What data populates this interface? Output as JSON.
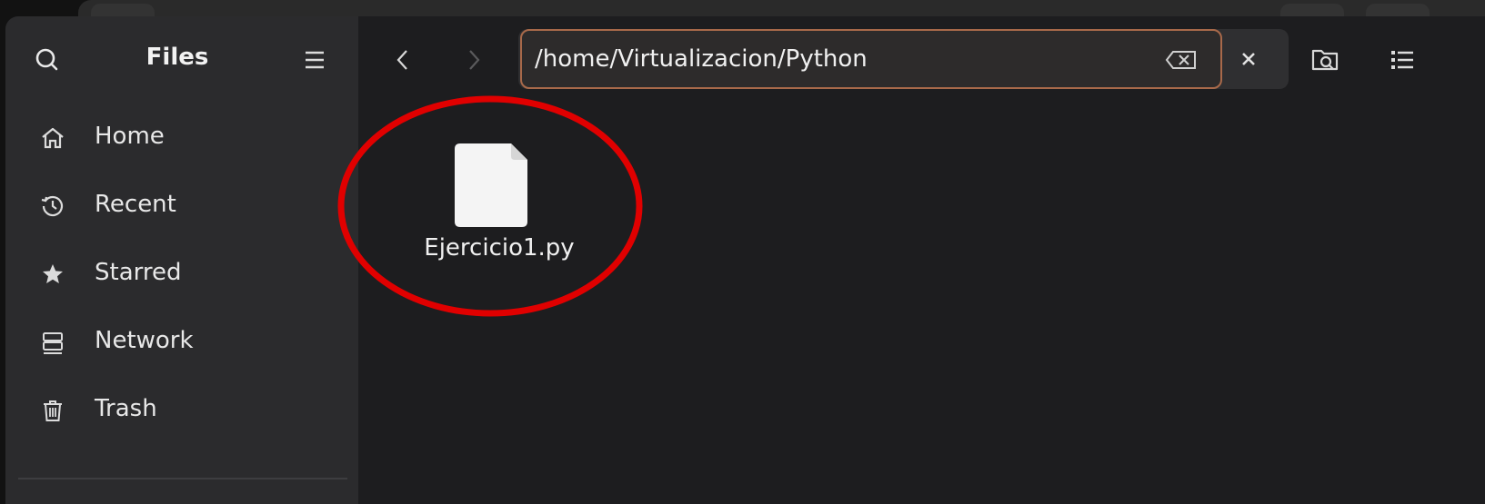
{
  "sidebar": {
    "title": "Files",
    "items": [
      {
        "label": "Home",
        "icon": "home-icon"
      },
      {
        "label": "Recent",
        "icon": "clock-icon"
      },
      {
        "label": "Starred",
        "icon": "star-icon"
      },
      {
        "label": "Network",
        "icon": "network-icon"
      },
      {
        "label": "Trash",
        "icon": "trash-icon"
      }
    ]
  },
  "toolbar": {
    "path_value": "/home/Virtualizacion/Python"
  },
  "files": [
    {
      "name": "Ejercicio1.py",
      "icon": "file-icon"
    }
  ],
  "colors": {
    "highlight": "#e00000",
    "path_border": "#a8694a",
    "sidebar_bg": "#2b2b2d",
    "main_bg": "#1d1d1f"
  }
}
